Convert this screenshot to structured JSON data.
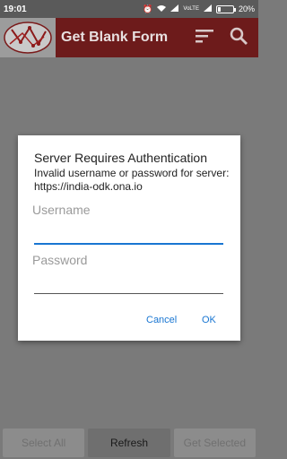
{
  "status_bar": {
    "time": "19:01",
    "network_label": "VoLTE",
    "battery": "20%",
    "battery_level": 0.2
  },
  "app_bar": {
    "title": "Get Blank Form",
    "sort_icon": "sort-icon",
    "search_icon": "search-icon"
  },
  "dialog": {
    "title": "Server Requires Authentication",
    "message": "Invalid username or password for server: https://india-odk.ona.io",
    "username_placeholder": "Username",
    "password_placeholder": "Password",
    "cancel_label": "Cancel",
    "ok_label": "OK"
  },
  "bottom_bar": {
    "select_all_label": "Select All",
    "refresh_label": "Refresh",
    "get_selected_label": "Get Selected"
  },
  "colors": {
    "app_bar": "#6d1b1b",
    "accent": "#1976d2",
    "overlay": "#7a7a7a"
  }
}
